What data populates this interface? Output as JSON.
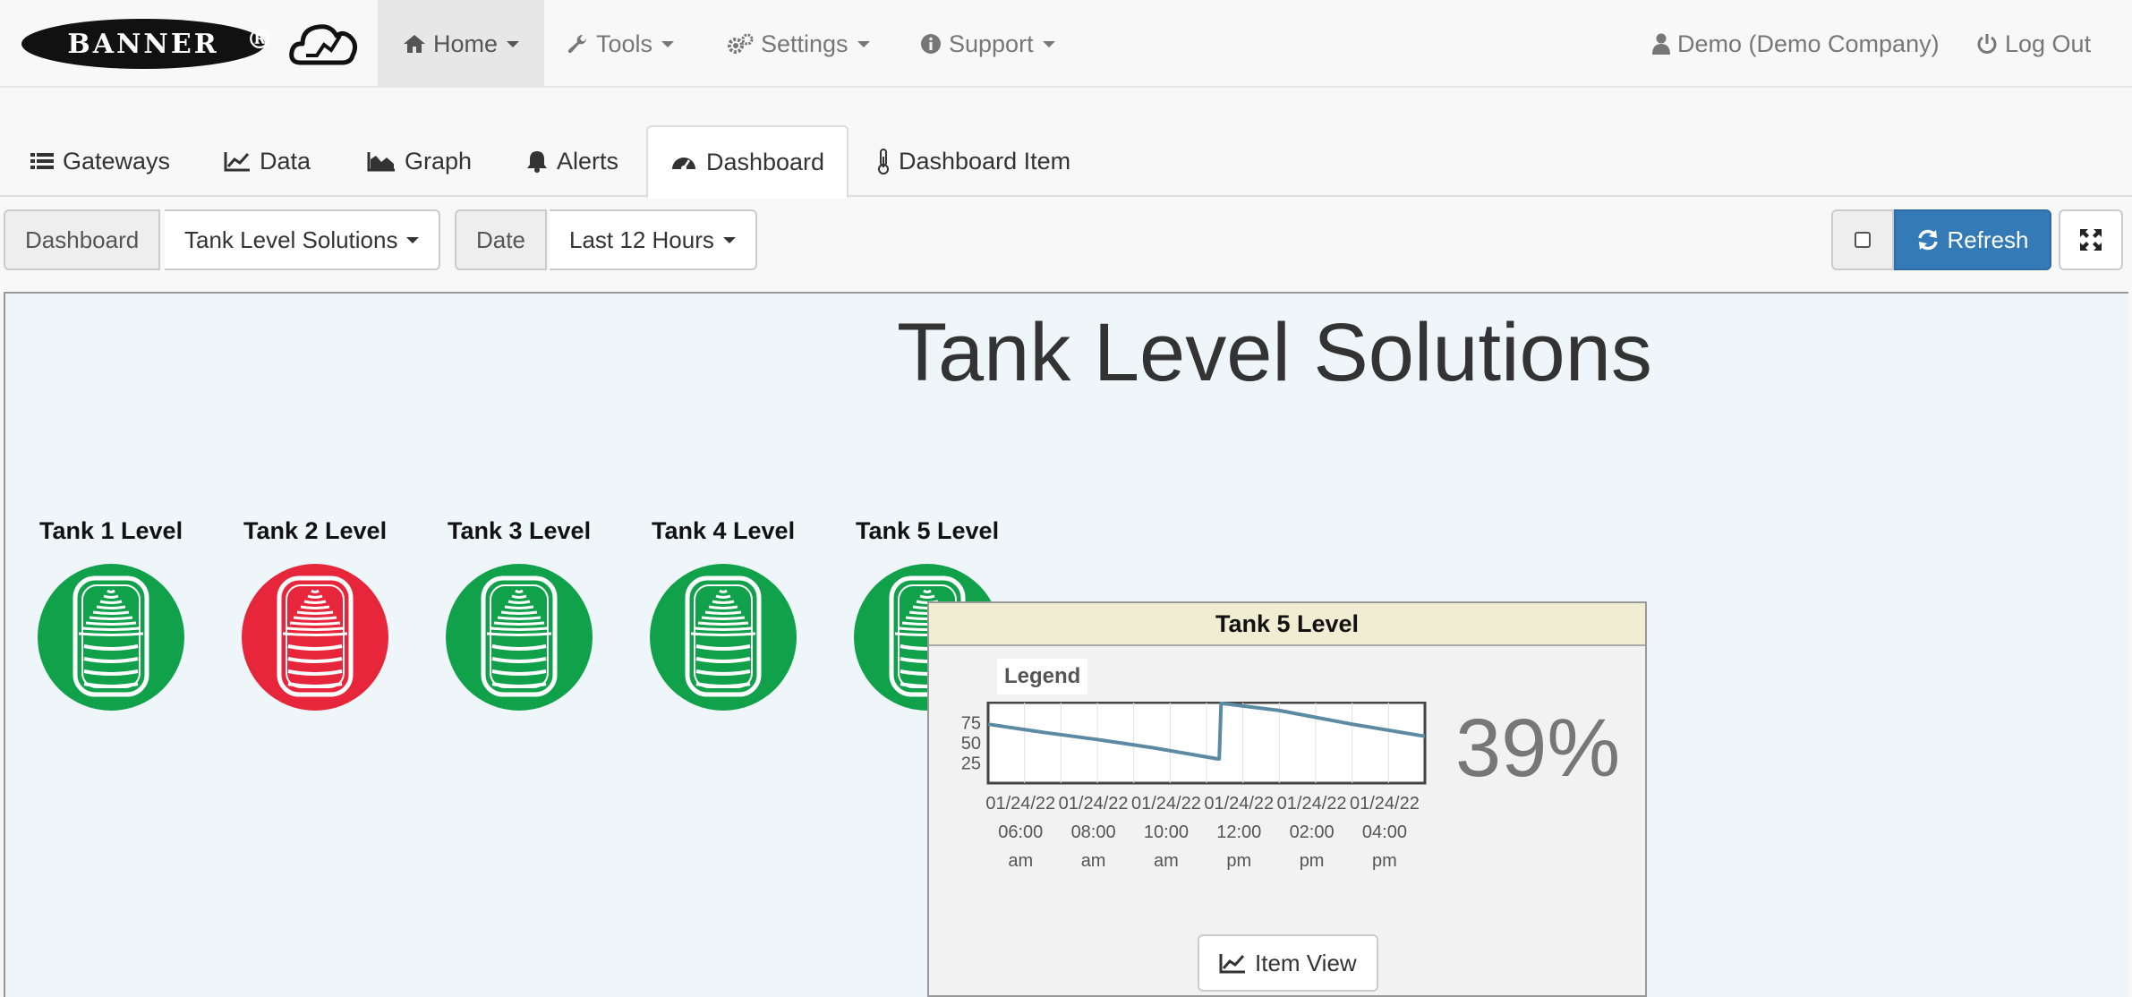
{
  "brand": {
    "logo_text": "BANNER",
    "reg_mark": "®"
  },
  "nav": {
    "home": "Home",
    "tools": "Tools",
    "settings": "Settings",
    "support": "Support",
    "user": "Demo (Demo Company)",
    "logout": "Log Out"
  },
  "tabs": {
    "gateways": "Gateways",
    "data": "Data",
    "graph": "Graph",
    "alerts": "Alerts",
    "dashboard": "Dashboard",
    "dashboard_item": "Dashboard Item"
  },
  "toolbar": {
    "dashboard_label": "Dashboard",
    "dashboard_value": "Tank Level Solutions",
    "date_label": "Date",
    "date_value": "Last 12 Hours",
    "refresh": "Refresh"
  },
  "dashboard": {
    "title": "Tank Level Solutions",
    "tanks": [
      {
        "label": "Tank 1 Level",
        "status_color": "#12a14b"
      },
      {
        "label": "Tank 2 Level",
        "status_color": "#e8263b"
      },
      {
        "label": "Tank 3 Level",
        "status_color": "#12a14b"
      },
      {
        "label": "Tank 4 Level",
        "status_color": "#12a14b"
      },
      {
        "label": "Tank 5 Level",
        "status_color": "#12a14b"
      }
    ]
  },
  "popup": {
    "title": "Tank 5 Level",
    "legend": "Legend",
    "value": "39%",
    "item_view": "Item View"
  },
  "colors": {
    "accent": "#337ab7",
    "line": "#5b8aa3",
    "ok": "#12a14b",
    "alarm": "#e8263b"
  },
  "chart_data": {
    "type": "line",
    "title": "",
    "xlabel": "",
    "ylabel": "",
    "ylim": [
      0,
      100
    ],
    "yticks": [
      25,
      50,
      75
    ],
    "xlim": [
      0,
      12
    ],
    "x_tick_values": [
      0.4,
      2.4,
      4.4,
      6.4,
      8.4,
      10.4
    ],
    "x_tick_labels": [
      [
        "01/24/22",
        "06:00",
        "am"
      ],
      [
        "01/24/22",
        "08:00",
        "am"
      ],
      [
        "01/24/22",
        "10:00",
        "am"
      ],
      [
        "01/24/22",
        "12:00",
        "pm"
      ],
      [
        "01/24/22",
        "02:00",
        "pm"
      ],
      [
        "01/24/22",
        "04:00",
        "pm"
      ]
    ],
    "series": [
      {
        "points": [
          [
            0,
            72
          ],
          [
            1.5,
            62
          ],
          [
            3,
            53
          ],
          [
            4.5,
            43
          ],
          [
            6.3,
            29
          ],
          [
            6.35,
            29
          ],
          [
            6.4,
            100
          ],
          [
            8,
            89
          ],
          [
            10,
            72
          ],
          [
            12,
            57
          ]
        ]
      }
    ]
  }
}
